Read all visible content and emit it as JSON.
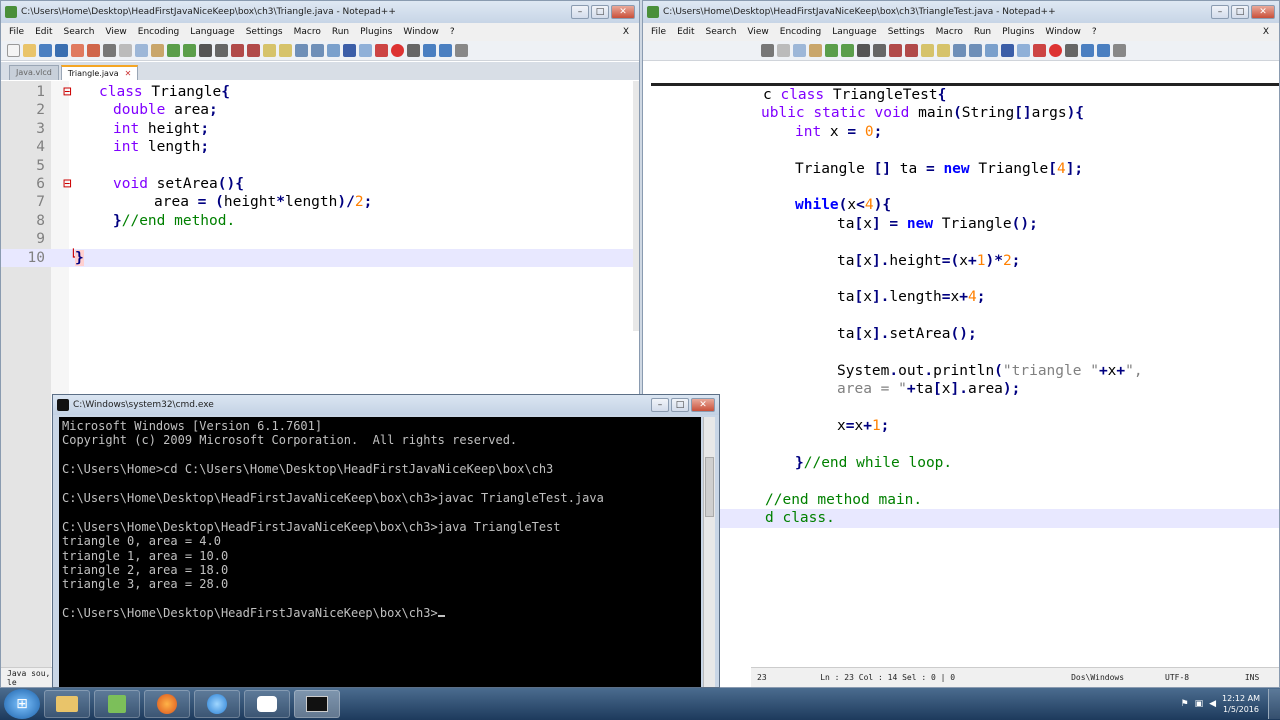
{
  "left_window": {
    "title": "C:\\Users\\Home\\Desktop\\HeadFirstJavaNiceKeep\\box\\ch3\\Triangle.java - Notepad++",
    "menu": [
      "File",
      "Edit",
      "Search",
      "View",
      "Encoding",
      "Language",
      "Settings",
      "Macro",
      "Run",
      "Plugins",
      "Window",
      "?"
    ],
    "menu_close": "X",
    "tabs": [
      {
        "label": "Java.vlcd"
      },
      {
        "label": "Triangle.java"
      }
    ],
    "status_left": "Java sou, le"
  },
  "right_window": {
    "title": "C:\\Users\\Home\\Desktop\\HeadFirstJavaNiceKeep\\box\\ch3\\TriangleTest.java - Notepad++",
    "menu": [
      "File",
      "Edit",
      "Search",
      "View",
      "Encoding",
      "Language",
      "Settings",
      "Macro",
      "Run",
      "Plugins",
      "Window",
      "?"
    ],
    "menu_close": "X",
    "status": {
      "length": "23",
      "pos": "Ln : 23   Col : 14   Sel : 0 | 0",
      "eol": "Dos\\Windows",
      "encoding": "UTF-8",
      "mode": "INS"
    }
  },
  "cmd_window": {
    "title": "C:\\Windows\\system32\\cmd.exe",
    "lines": [
      "Microsoft Windows [Version 6.1.7601]",
      "Copyright (c) 2009 Microsoft Corporation.  All rights reserved.",
      "",
      "C:\\Users\\Home>cd C:\\Users\\Home\\Desktop\\HeadFirstJavaNiceKeep\\box\\ch3",
      "",
      "C:\\Users\\Home\\Desktop\\HeadFirstJavaNiceKeep\\box\\ch3>javac TriangleTest.java",
      "",
      "C:\\Users\\Home\\Desktop\\HeadFirstJavaNiceKeep\\box\\ch3>java TriangleTest",
      "triangle 0, area = 4.0",
      "triangle 1, area = 10.0",
      "triangle 2, area = 18.0",
      "triangle 3, area = 28.0",
      "",
      "C:\\Users\\Home\\Desktop\\HeadFirstJavaNiceKeep\\box\\ch3>"
    ]
  },
  "taskbar": {
    "clock_time": "12:12 AM",
    "clock_date": "1/5/2016"
  }
}
